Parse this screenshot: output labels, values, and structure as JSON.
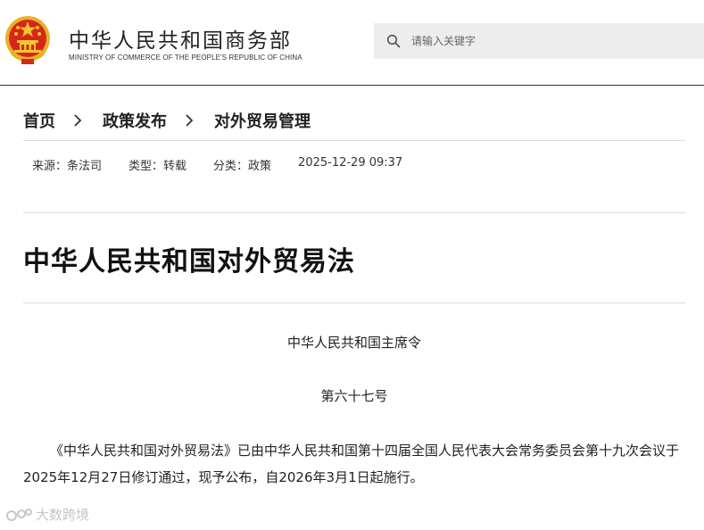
{
  "header": {
    "site_title": "中华人民共和国商务部",
    "site_subtitle": "MINISTRY OF COMMERCE OF THE PEOPLE'S REPUBLIC OF CHINA",
    "search_placeholder": "请输入关键字"
  },
  "breadcrumb": [
    "首页",
    "政策发布",
    "对外贸易管理"
  ],
  "meta": {
    "source": "来源：条法司",
    "type": "类型：转载",
    "category": "分类：政策",
    "datetime": "2025-12-29 09:37"
  },
  "article": {
    "title": "中华人民共和国对外贸易法",
    "decree_line": "中华人民共和国主席令",
    "decree_number": "第六十七号",
    "paragraph": "《中华人民共和国对外贸易法》已由中华人民共和国第十四届全国人民代表大会常务委员会第十九次会议于2025年12月27日修订通过，现予公布，自2026年3月1日起施行。"
  },
  "watermark": {
    "text": "大数跨境"
  },
  "colors": {
    "emblem_red": "#d7261b",
    "emblem_gold": "#f4c430",
    "search_bg": "#ededed",
    "divider": "#dcdcdc"
  },
  "icons": [
    "national-emblem-icon",
    "search-icon",
    "chevron-right-icon"
  ]
}
